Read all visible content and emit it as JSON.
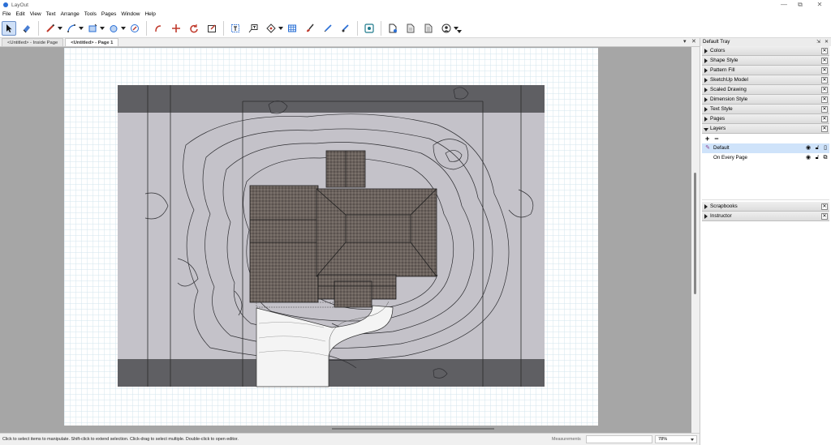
{
  "app": {
    "title": "LayOut",
    "window_controls": [
      "—",
      "⧉",
      "✕"
    ]
  },
  "menu": [
    "File",
    "Edit",
    "View",
    "Text",
    "Arrange",
    "Tools",
    "Pages",
    "Window",
    "Help"
  ],
  "toolbar": {
    "tools": [
      {
        "icon": "select-arrow-icon",
        "active": true
      },
      {
        "icon": "eraser-icon"
      },
      {
        "icon": "pencil-line-icon",
        "dropdown": true
      },
      {
        "icon": "arc-icon",
        "dropdown": true
      },
      {
        "icon": "rectangle-icon",
        "dropdown": true
      },
      {
        "icon": "circle-icon",
        "dropdown": true
      },
      {
        "icon": "offset-icon"
      },
      {
        "icon": "split-icon"
      },
      {
        "icon": "join-icon"
      },
      {
        "icon": "rotate-icon"
      },
      {
        "icon": "scale-icon"
      },
      {
        "icon": "text-icon"
      },
      {
        "icon": "label-icon"
      },
      {
        "icon": "dimension-icon",
        "dropdown": true
      },
      {
        "icon": "table-icon"
      },
      {
        "icon": "style-brush-icon"
      },
      {
        "icon": "sample-icon"
      },
      {
        "icon": "split-line-icon"
      },
      {
        "icon": "screen-presentation-icon"
      },
      {
        "icon": "add-page-icon"
      },
      {
        "icon": "page-icon"
      },
      {
        "icon": "document-icon"
      },
      {
        "icon": "user-icon",
        "dropdown": true
      }
    ]
  },
  "tabs": [
    {
      "label": "<Untitled> - Inside Page",
      "selected": false
    },
    {
      "label": "<Untitled> - Page 1",
      "selected": true
    }
  ],
  "tray": {
    "title": "Default Tray",
    "panels_top": [
      "Colors",
      "Shape Style",
      "Pattern Fill",
      "SketchUp Model",
      "Scaled Drawing",
      "Dimension Style",
      "Text Style",
      "Pages"
    ],
    "layers": {
      "title": "Layers",
      "add": "+",
      "remove": "−",
      "items": [
        {
          "name": "Default",
          "selected": true
        },
        {
          "name": "On Every Page",
          "selected": false
        }
      ]
    },
    "panels_bottom": [
      "Scrapbooks",
      "Instructor"
    ]
  },
  "status": {
    "message": "Click to select items to manipulate. Shift-click to extend selection. Click-drag to select multiple. Double-click to open editor.",
    "measurements_label": "Measurements",
    "measurements_value": "",
    "zoom": "78%"
  }
}
